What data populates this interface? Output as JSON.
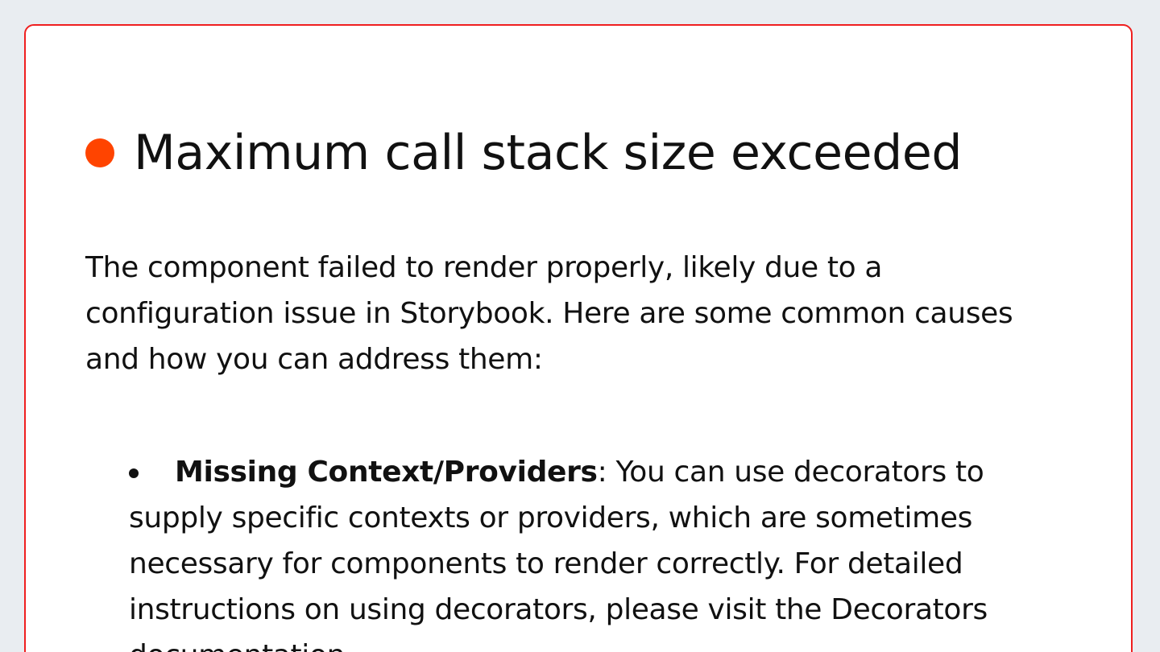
{
  "error": {
    "title": "Maximum call stack size exceeded",
    "intro": "The component failed to render properly, likely due to a configuration issue in Storybook. Here are some common causes and how you can address them:",
    "causes": [
      {
        "title": "Missing Context/Providers",
        "separator": ":",
        "text": " You can use decorators to supply specific contexts or providers, which are sometimes necessary for components to render correctly. For detailed instructions on using decorators, please visit the Decorators documentation."
      }
    ]
  },
  "colors": {
    "accent": "#ff4400",
    "border": "#ef1f1f",
    "background": "#e9edf1"
  }
}
